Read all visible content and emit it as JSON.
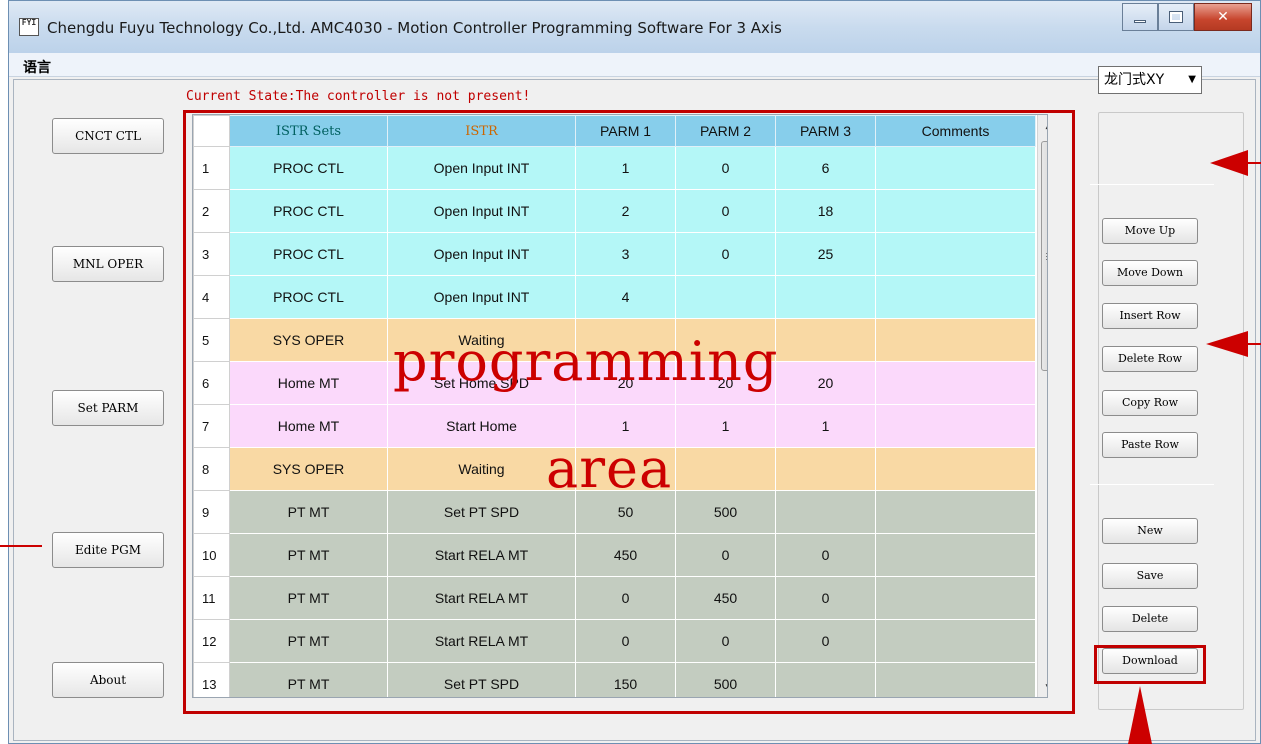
{
  "window": {
    "title": "Chengdu Fuyu Technology Co.,Ltd.  AMC4030 -  Motion Controller Programming Software For 3 Axis",
    "icon_label": "FYI"
  },
  "menu": {
    "language": "语言"
  },
  "status": {
    "text": "Current State:The controller is not present!"
  },
  "left_buttons": [
    {
      "label": "CNCT CTL"
    },
    {
      "label": "MNL OPER"
    },
    {
      "label": "Set PARM"
    },
    {
      "label": "Edite PGM"
    },
    {
      "label": "About"
    }
  ],
  "table": {
    "headers": [
      "",
      "ISTR Sets",
      "ISTR",
      "PARM 1",
      "PARM 2",
      "PARM 3",
      "Comments"
    ],
    "rows": [
      {
        "n": "1",
        "set": "PROC CTL",
        "istr": "Open Input INT",
        "p1": "1",
        "p2": "0",
        "p3": "6",
        "cm": "",
        "color": "cyan"
      },
      {
        "n": "2",
        "set": "PROC CTL",
        "istr": "Open Input INT",
        "p1": "2",
        "p2": "0",
        "p3": "18",
        "cm": "",
        "color": "cyan"
      },
      {
        "n": "3",
        "set": "PROC CTL",
        "istr": "Open Input INT",
        "p1": "3",
        "p2": "0",
        "p3": "25",
        "cm": "",
        "color": "cyan"
      },
      {
        "n": "4",
        "set": "PROC CTL",
        "istr": "Open Input INT",
        "p1": "4",
        "p2": "",
        "p3": "",
        "cm": "",
        "color": "cyan"
      },
      {
        "n": "5",
        "set": "SYS OPER",
        "istr": "Waiting",
        "p1": "",
        "p2": "",
        "p3": "",
        "cm": "",
        "color": "orange"
      },
      {
        "n": "6",
        "set": "Home MT",
        "istr": "Set Home SPD",
        "p1": "20",
        "p2": "20",
        "p3": "20",
        "cm": "",
        "color": "pink"
      },
      {
        "n": "7",
        "set": "Home MT",
        "istr": "Start Home",
        "p1": "1",
        "p2": "1",
        "p3": "1",
        "cm": "",
        "color": "pink"
      },
      {
        "n": "8",
        "set": "SYS OPER",
        "istr": "Waiting",
        "p1": "",
        "p2": "",
        "p3": "",
        "cm": "",
        "color": "orange"
      },
      {
        "n": "9",
        "set": "PT MT",
        "istr": "Set PT SPD",
        "p1": "50",
        "p2": "500",
        "p3": "",
        "cm": "",
        "color": "gray"
      },
      {
        "n": "10",
        "set": "PT MT",
        "istr": "Start RELA MT",
        "p1": "450",
        "p2": "0",
        "p3": "0",
        "cm": "",
        "color": "gray"
      },
      {
        "n": "11",
        "set": "PT MT",
        "istr": "Start RELA MT",
        "p1": "0",
        "p2": "450",
        "p3": "0",
        "cm": "",
        "color": "gray"
      },
      {
        "n": "12",
        "set": "PT MT",
        "istr": "Start RELA MT",
        "p1": "0",
        "p2": "0",
        "p3": "0",
        "cm": "",
        "color": "gray"
      },
      {
        "n": "13",
        "set": "PT MT",
        "istr": "Set PT SPD",
        "p1": "150",
        "p2": "500",
        "p3": "",
        "cm": "",
        "color": "gray"
      }
    ]
  },
  "right_panel": {
    "combo_value": "龙门式XY",
    "row_buttons": [
      "Move Up",
      "Move Down",
      "Insert Row",
      "Delete Row",
      "Copy Row",
      "Paste Row"
    ],
    "file_buttons": [
      "New",
      "Save",
      "Delete",
      "Download"
    ]
  },
  "annotation": {
    "line1": "programming",
    "line2": "area"
  },
  "colors": {
    "accent": "#c00000",
    "header": "#87ceeb",
    "cyan": "#b4f7f7",
    "orange": "#f9d9a4",
    "pink": "#fbd9fb",
    "gray": "#c3ccc0"
  }
}
